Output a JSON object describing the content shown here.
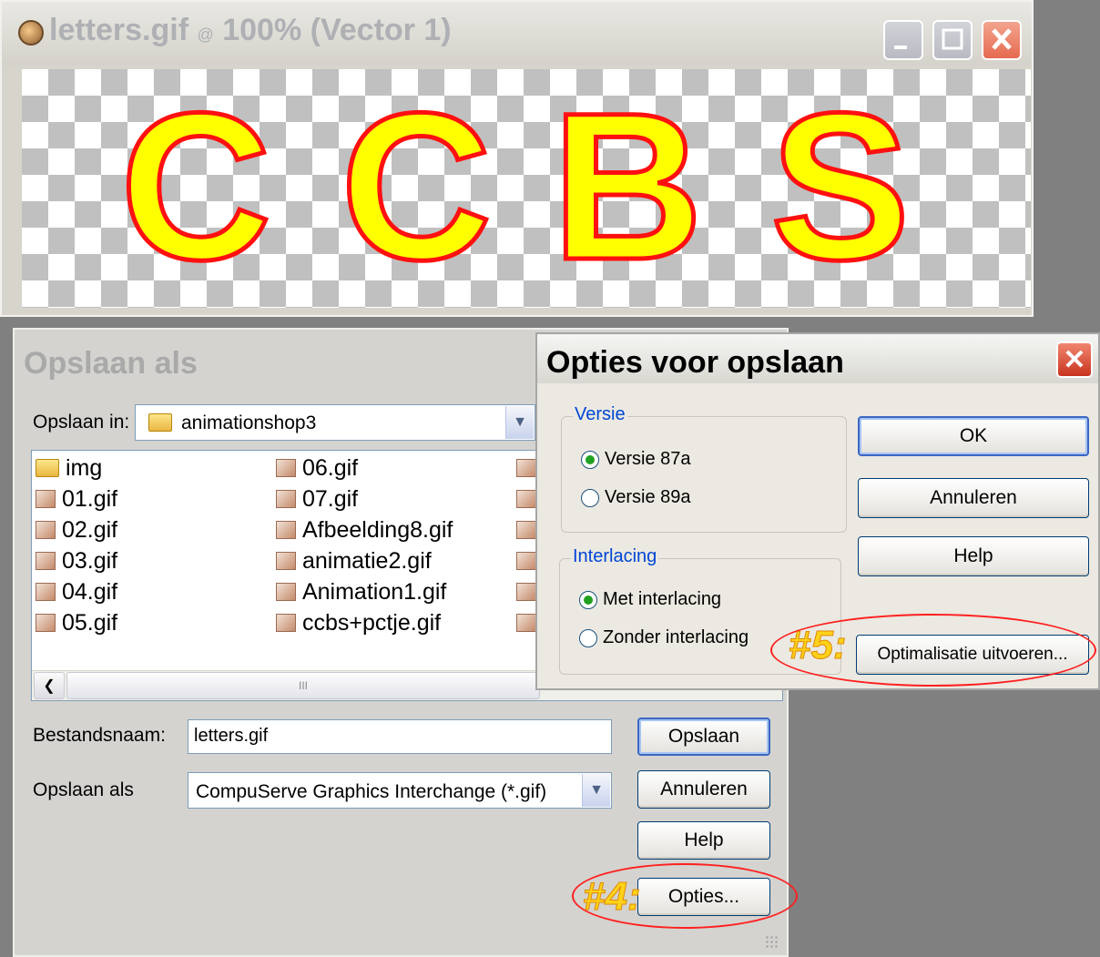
{
  "image_window": {
    "title": "letters.gif",
    "title_at": "@",
    "title_zoom": "100% (Vector 1)",
    "letters": [
      "C",
      "C",
      "B",
      "S"
    ]
  },
  "save_dialog": {
    "title": "Opslaan als",
    "save_in_label": "Opslaan in:",
    "save_in_value": "animationshop3",
    "files": [
      {
        "name": "img",
        "icon": "folder-icon"
      },
      {
        "name": "01.gif",
        "icon": "gif-file-icon"
      },
      {
        "name": "02.gif",
        "icon": "gif-file-icon"
      },
      {
        "name": "03.gif",
        "icon": "gif-file-icon"
      },
      {
        "name": "04.gif",
        "icon": "gif-file-icon"
      },
      {
        "name": "05.gif",
        "icon": "gif-file-icon"
      },
      {
        "name": "06.gif",
        "icon": "gif-file-icon"
      },
      {
        "name": "07.gif",
        "icon": "gif-file-icon"
      },
      {
        "name": "Afbeelding8.gif",
        "icon": "gif-file-icon"
      },
      {
        "name": "animatie2.gif",
        "icon": "gif-file-icon"
      },
      {
        "name": "Animation1.gif",
        "icon": "gif-file-icon"
      },
      {
        "name": "ccbs+pctje.gif",
        "icon": "gif-file-icon"
      }
    ],
    "scroll_thumb": "III",
    "filename_label": "Bestandsnaam:",
    "filename_value": "letters.gif",
    "type_label": "Opslaan als",
    "type_value": "CompuServe Graphics Interchange (*.gif)",
    "save_button": "Opslaan",
    "cancel_button": "Annuleren",
    "help_button": "Help",
    "options_button": "Opties...",
    "annotation": "#4:"
  },
  "options_dialog": {
    "title": "Opties voor opslaan",
    "version_group": "Versie",
    "version_87a": "Versie 87a",
    "version_89a": "Versie 89a",
    "interlacing_group": "Interlacing",
    "with_interlacing": "Met interlacing",
    "without_interlacing": "Zonder interlacing",
    "ok_button": "OK",
    "cancel_button": "Annuleren",
    "help_button": "Help",
    "optimize_button": "Optimalisatie uitvoeren...",
    "annotation": "#5:"
  },
  "colors": {
    "letter_fill": "#ffff00",
    "letter_outline": "#ff1010",
    "annotation_ring": "#ff2020",
    "annotation_text": "#ffd21a",
    "group_label": "#0046d5"
  }
}
